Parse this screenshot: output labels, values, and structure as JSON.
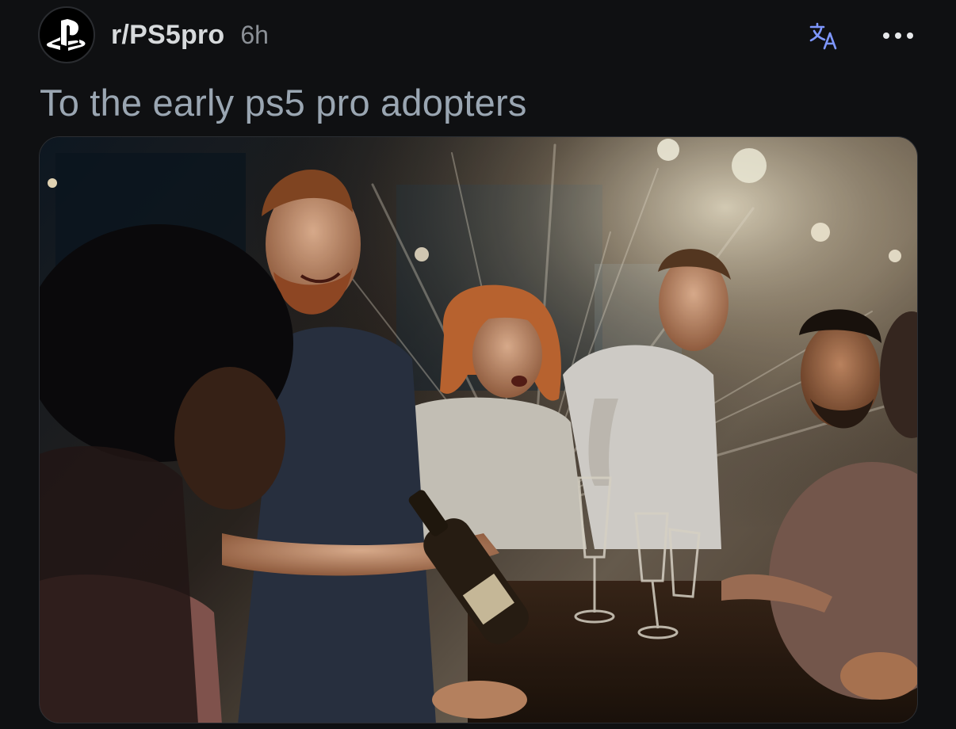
{
  "post": {
    "subreddit": "r/PS5pro",
    "age": "6h",
    "title": "To the early ps5 pro adopters",
    "avatar_icon": "playstation-logo-icon",
    "translate_icon": "translate-icon",
    "more_icon": "more-options-icon"
  },
  "colors": {
    "background": "#0f1012",
    "title_text": "#9aa6b2",
    "accent_translate": "#7e97ff"
  }
}
